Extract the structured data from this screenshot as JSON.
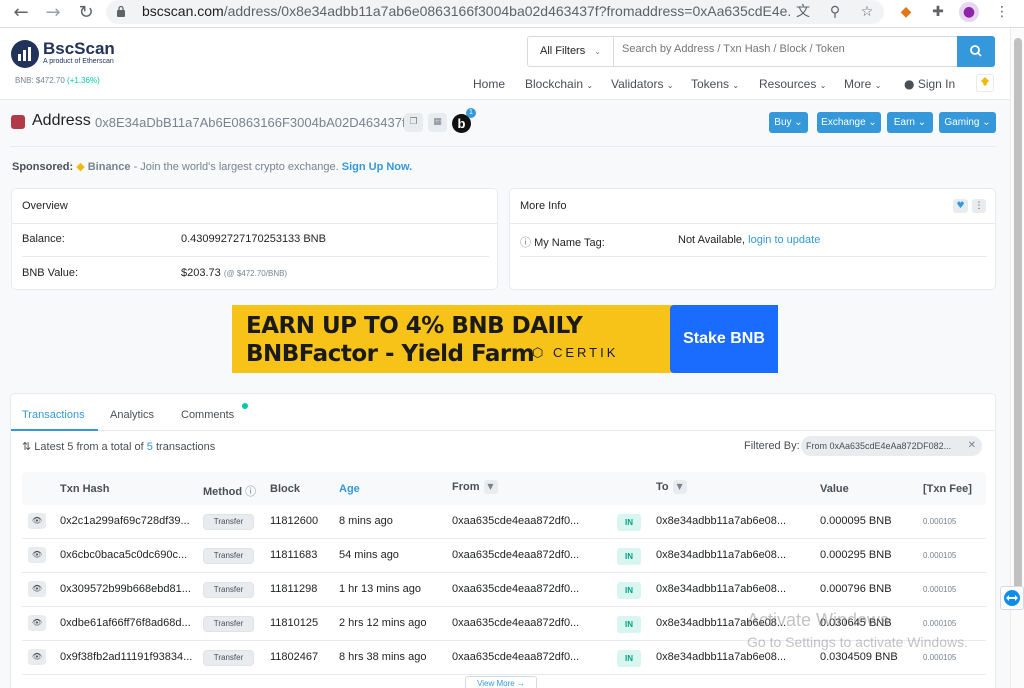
{
  "browser": {
    "url_host": "bscscan.com",
    "url_path": "/address/0x8e34adbb11a7ab6e0863166f3004ba02d463437f?fromaddress=0xAa635cdE4e..."
  },
  "header": {
    "logo_title": "BscScan",
    "logo_subtitle": "A product of Etherscan",
    "price_label": "BNB: $472.70",
    "price_change": "(+1.36%)",
    "filter_label": "All Filters",
    "search_placeholder": "Search by Address / Txn Hash / Block / Token",
    "menu": [
      "Home",
      "Blockchain",
      "Validators",
      "Tokens",
      "Resources",
      "More",
      "Sign In"
    ]
  },
  "address": {
    "label": "Address",
    "hash": "0x8E34aDbB11a7Ab6E0863166F3004bA02D463437f",
    "badge_letter": "b",
    "badge_count": "1",
    "buttons": [
      "Buy",
      "Exchange",
      "Earn",
      "Gaming"
    ]
  },
  "sponsored": {
    "label": "Sponsored:",
    "name": "Binance",
    "text": " - Join the world's largest crypto exchange.",
    "link": "Sign Up Now."
  },
  "overview": {
    "title": "Overview",
    "balance_label": "Balance:",
    "balance_value": "0.430992727170253133 BNB",
    "value_label": "BNB Value:",
    "value_amount": "$203.73",
    "value_note": "(@ $472.70/BNB)"
  },
  "more_info": {
    "title": "More Info",
    "tag_label": "My Name Tag:",
    "tag_value": "Not Available,",
    "tag_link": "login to update"
  },
  "banner": {
    "line1": "EARN UP TO 4% BNB DAILY",
    "line2": "BNBFactor - Yield Farm",
    "brand": "CERTIK",
    "cta": "Stake BNB"
  },
  "tabs": [
    "Transactions",
    "Analytics",
    "Comments"
  ],
  "table": {
    "summary_prefix": "Latest 5 from a total of",
    "summary_count": "5",
    "summary_suffix": "transactions",
    "filtered_label": "Filtered By:",
    "filter_chip": "From 0xAa635cdE4eAa872DF082...",
    "columns": [
      "Txn Hash",
      "Method",
      "Block",
      "Age",
      "From",
      "To",
      "Value",
      "[Txn Fee]"
    ],
    "rows": [
      {
        "hash": "0x2c1a299af69c728df39...",
        "method": "Transfer",
        "block": "11812600",
        "age": "8 mins ago",
        "from": "0xaa635cde4eaa872df0...",
        "dir": "IN",
        "to": "0x8e34adbb11a7ab6e08...",
        "value": "0.000095 BNB",
        "fee": "0.000105"
      },
      {
        "hash": "0x6cbc0baca5c0dc690c...",
        "method": "Transfer",
        "block": "11811683",
        "age": "54 mins ago",
        "from": "0xaa635cde4eaa872df0...",
        "dir": "IN",
        "to": "0x8e34adbb11a7ab6e08...",
        "value": "0.000295 BNB",
        "fee": "0.000105"
      },
      {
        "hash": "0x309572b99b668ebd81...",
        "method": "Transfer",
        "block": "11811298",
        "age": "1 hr 13 mins ago",
        "from": "0xaa635cde4eaa872df0...",
        "dir": "IN",
        "to": "0x8e34adbb11a7ab6e08...",
        "value": "0.000796 BNB",
        "fee": "0.000105"
      },
      {
        "hash": "0xdbe61af66ff76f8ad68d...",
        "method": "Transfer",
        "block": "11810125",
        "age": "2 hrs 12 mins ago",
        "from": "0xaa635cde4eaa872df0...",
        "dir": "IN",
        "to": "0x8e34adbb11a7ab6e08...",
        "value": "0.030645 BNB",
        "fee": "0.000105"
      },
      {
        "hash": "0x9f38fb2ad11191f93834...",
        "method": "Transfer",
        "block": "11802467",
        "age": "8 hrs 38 mins ago",
        "from": "0xaa635cde4eaa872df0...",
        "dir": "IN",
        "to": "0x8e34adbb11a7ab6e08...",
        "value": "0.0304509 BNB",
        "fee": "0.000105"
      }
    ],
    "view_more": "View More →"
  },
  "watermark": {
    "line1": "Activate Windows",
    "line2": "Go to Settings to activate Windows."
  },
  "colors": {
    "accent": "#3498db",
    "brand_dark": "#21325b",
    "banner_yellow": "#f7c319",
    "banner_blue": "#1a6bff",
    "in_green": "#00a186"
  }
}
